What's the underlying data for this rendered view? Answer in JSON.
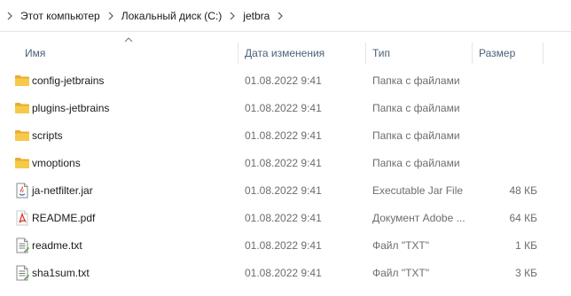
{
  "breadcrumb": {
    "items": [
      {
        "label": "Этот компьютер"
      },
      {
        "label": "Локальный диск (C:)"
      },
      {
        "label": "jetbra"
      }
    ]
  },
  "columns": {
    "name": "Имя",
    "date": "Дата изменения",
    "type": "Тип",
    "size": "Размер"
  },
  "files": [
    {
      "name": "config-jetbrains",
      "date": "01.08.2022 9:41",
      "type": "Папка с файлами",
      "size": "",
      "icon": "folder-icon"
    },
    {
      "name": "plugins-jetbrains",
      "date": "01.08.2022 9:41",
      "type": "Папка с файлами",
      "size": "",
      "icon": "folder-icon"
    },
    {
      "name": "scripts",
      "date": "01.08.2022 9:41",
      "type": "Папка с файлами",
      "size": "",
      "icon": "folder-icon"
    },
    {
      "name": "vmoptions",
      "date": "01.08.2022 9:41",
      "type": "Папка с файлами",
      "size": "",
      "icon": "folder-icon"
    },
    {
      "name": "ja-netfilter.jar",
      "date": "01.08.2022 9:41",
      "type": "Executable Jar File",
      "size": "48 КБ",
      "icon": "jar-file-icon"
    },
    {
      "name": "README.pdf",
      "date": "01.08.2022 9:41",
      "type": "Документ Adobe ...",
      "size": "64 КБ",
      "icon": "pdf-file-icon"
    },
    {
      "name": "readme.txt",
      "date": "01.08.2022 9:41",
      "type": "Файл \"TXT\"",
      "size": "1 КБ",
      "icon": "text-file-icon"
    },
    {
      "name": "sha1sum.txt",
      "date": "01.08.2022 9:41",
      "type": "Файл \"TXT\"",
      "size": "3 КБ",
      "icon": "text-file-icon"
    }
  ],
  "colors": {
    "folder": "#f7c94b",
    "folder_dark": "#e8ad2c",
    "pdf": "#d83b2a",
    "header_text": "#4c607a",
    "muted_text": "#6d6d6d"
  }
}
